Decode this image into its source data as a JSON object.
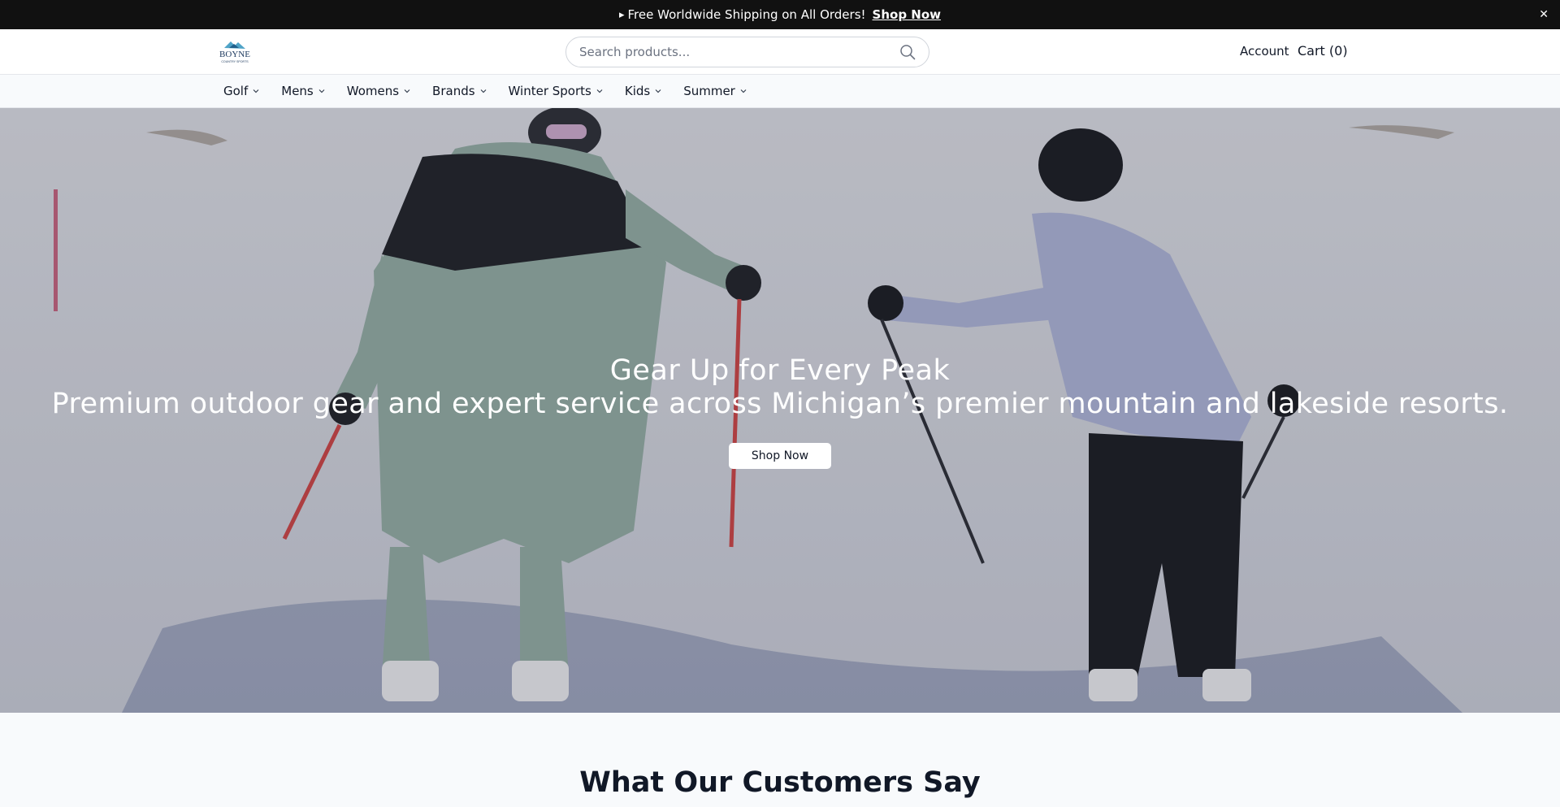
{
  "announcement": {
    "icon": "megaphone-icon",
    "text": "Free Worldwide Shipping on All Orders!",
    "link_label": "Shop Now",
    "close_icon": "close-icon"
  },
  "header": {
    "logo": {
      "line1": "BOYNE",
      "line2": "COUNTRY SPORTS"
    },
    "search": {
      "placeholder": "Search products...",
      "value": ""
    },
    "account_label": "Account",
    "cart_label": "Cart (0)"
  },
  "nav": {
    "items": [
      {
        "label": "Golf"
      },
      {
        "label": "Mens"
      },
      {
        "label": "Womens"
      },
      {
        "label": "Brands"
      },
      {
        "label": "Winter Sports"
      },
      {
        "label": "Kids"
      },
      {
        "label": "Summer"
      }
    ]
  },
  "hero": {
    "title": "Gear Up for Every Peak",
    "subtitle": "Premium outdoor gear and expert service across Michigan’s premier mountain and lakeside resorts.",
    "cta_label": "Shop Now"
  },
  "testimonials": {
    "heading": "What Our Customers Say"
  },
  "colors": {
    "announcement_bg": "#111111",
    "header_bg": "#ffffff",
    "nav_bg": "#f8fafc",
    "text": "#111827"
  }
}
